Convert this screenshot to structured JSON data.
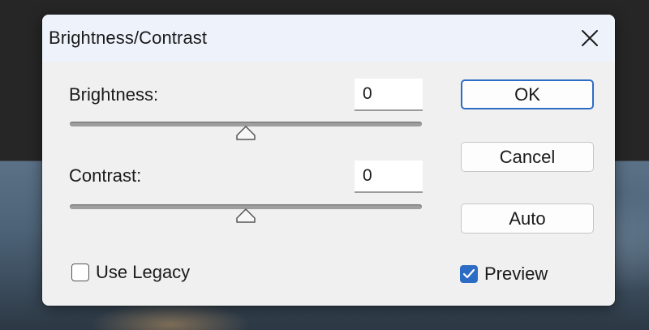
{
  "dialog": {
    "title": "Brightness/Contrast",
    "close_icon": "close-icon"
  },
  "brightness": {
    "label": "Brightness:",
    "value": "0",
    "slider_level": 0.5
  },
  "contrast": {
    "label": "Contrast:",
    "value": "0",
    "slider_level": 0.5
  },
  "buttons": {
    "ok": "OK",
    "cancel": "Cancel",
    "auto": "Auto"
  },
  "options": {
    "use_legacy": {
      "label": "Use Legacy",
      "checked": false
    },
    "preview": {
      "label": "Preview",
      "checked": true
    }
  },
  "colors": {
    "accent": "#2d6cc4",
    "dialog_background": "#f0f0f0",
    "title_bar": "#eef3fb"
  }
}
